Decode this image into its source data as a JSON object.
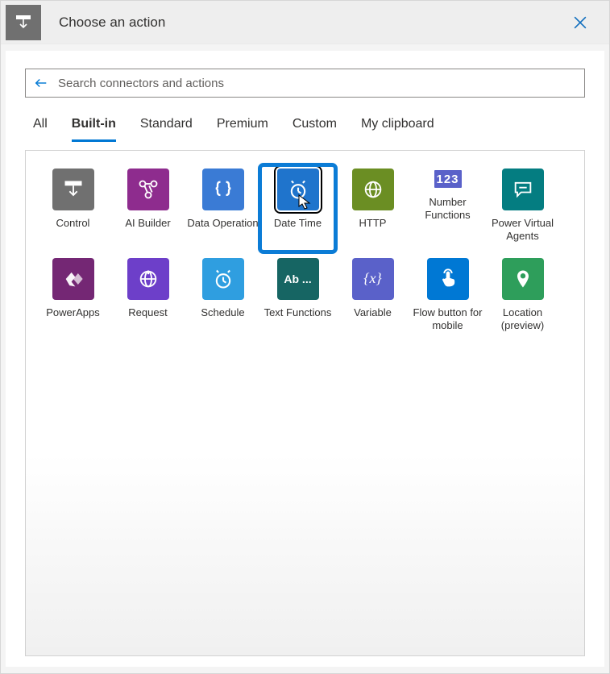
{
  "header": {
    "title": "Choose an action"
  },
  "search": {
    "placeholder": "Search connectors and actions"
  },
  "tabs": {
    "all": "All",
    "builtin": "Built-in",
    "standard": "Standard",
    "premium": "Premium",
    "custom": "Custom",
    "clipboard": "My clipboard"
  },
  "connectors": {
    "0": {
      "label": "Control"
    },
    "1": {
      "label": "AI Builder"
    },
    "2": {
      "label": "Data Operation"
    },
    "3": {
      "label": "Date Time"
    },
    "4": {
      "label": "HTTP"
    },
    "5": {
      "label": "Number Functions"
    },
    "6": {
      "label": "Power Virtual Agents"
    },
    "7": {
      "label": "PowerApps"
    },
    "8": {
      "label": "Request"
    },
    "9": {
      "label": "Schedule"
    },
    "10": {
      "label": "Text Functions",
      "tile_text": "Ab ..."
    },
    "11": {
      "label": "Variable",
      "tile_text": "{x}"
    },
    "12": {
      "label": "Flow button for mobile"
    },
    "13": {
      "label": "Location (preview)"
    },
    "numbers_tile": "123"
  },
  "ui_state": {
    "active_tab": "builtin",
    "selected_connector": 3
  }
}
